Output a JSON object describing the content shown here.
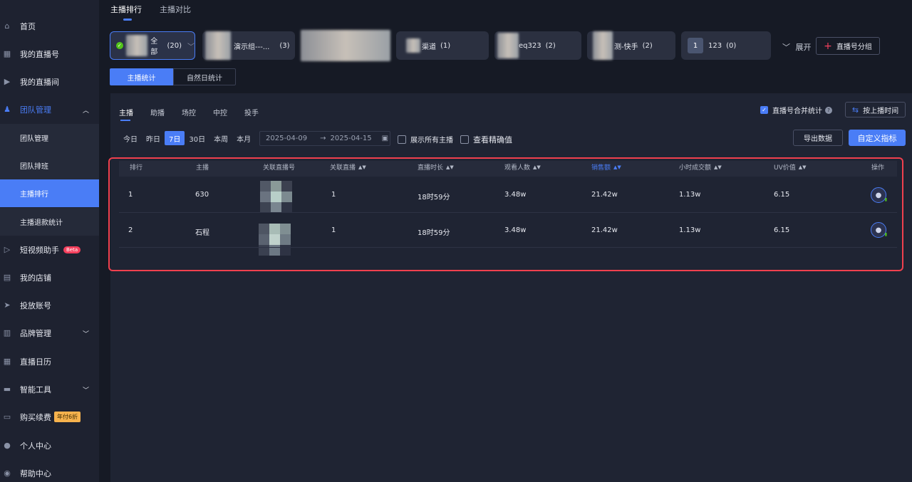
{
  "sidebar": {
    "items": [
      {
        "label": "首页",
        "icon": "home-icon",
        "glyph": "⌂"
      },
      {
        "label": "我的直播号",
        "icon": "grid-icon",
        "glyph": "▦"
      },
      {
        "label": "我的直播间",
        "icon": "play-icon",
        "glyph": "▶"
      },
      {
        "label": "团队管理",
        "icon": "team-icon",
        "glyph": "♟",
        "chevron": "︿"
      },
      {
        "label": "团队管理"
      },
      {
        "label": "团队排班"
      },
      {
        "label": "主播排行"
      },
      {
        "label": "主播退款统计"
      },
      {
        "label": "短视频助手",
        "icon": "video-icon",
        "glyph": "▷",
        "badge": "Beta"
      },
      {
        "label": "我的店铺",
        "icon": "store-icon",
        "glyph": "▤"
      },
      {
        "label": "投放账号",
        "icon": "send-icon",
        "glyph": "➤"
      },
      {
        "label": "品牌管理",
        "icon": "chart-icon",
        "glyph": "▥",
        "chevron": "﹀"
      },
      {
        "label": "直播日历",
        "icon": "calendar-icon",
        "glyph": "▦"
      },
      {
        "label": "智能工具",
        "icon": "tool-icon",
        "glyph": "▬",
        "chevron": "﹀"
      },
      {
        "label": "购买续费",
        "icon": "card-icon",
        "glyph": "▭",
        "badge": "年付6折"
      },
      {
        "label": "个人中心",
        "icon": "user-icon",
        "glyph": "●"
      },
      {
        "label": "帮助中心",
        "icon": "help-icon",
        "glyph": "◉"
      }
    ]
  },
  "top_tabs": [
    "主播排行",
    "主播对比"
  ],
  "groups": [
    {
      "label": "全部",
      "count": "(20)",
      "chevron": "﹀"
    },
    {
      "label": "演示组---...",
      "count": "(3)"
    },
    {
      "label": "渠道",
      "count": "(1)"
    },
    {
      "label": "eq323",
      "count": "(2)"
    },
    {
      "label": "测-快手",
      "count": "(2)"
    },
    {
      "number": "1",
      "label": "123",
      "count": "(0)"
    }
  ],
  "expand": {
    "chevron": "﹀",
    "label": "展开"
  },
  "add_group": {
    "plus": "+",
    "label": "直播号分组"
  },
  "stat_toggle": [
    "主播统计",
    "自然日统计"
  ],
  "sub_tabs": [
    "主播",
    "助播",
    "场控",
    "中控",
    "投手"
  ],
  "merge": {
    "check": "✓",
    "label": "直播号合并统计",
    "help": "?"
  },
  "sort_time": {
    "icon": "⇆",
    "label": "按上播时间"
  },
  "quick_range": [
    "今日",
    "昨日",
    "7日",
    "30日",
    "本周",
    "本月"
  ],
  "date": {
    "start": "2025-04-09",
    "arrow": "→",
    "end": "2025-04-15",
    "cal": "▣"
  },
  "options": {
    "show_all": "展示所有主播",
    "precise": "查看精确值"
  },
  "buttons": {
    "export": "导出数据",
    "custom": "自定义指标"
  },
  "table": {
    "sort_glyph": "▲▼",
    "headers": [
      "排行",
      "主播",
      "关联直播号",
      "关联直播",
      "直播时长",
      "观看人数",
      "销售额",
      "小时成交额",
      "UV价值",
      "操作"
    ],
    "rows": [
      [
        "1",
        "630",
        "",
        "1",
        "18时59分",
        "3.48w",
        "21.42w",
        "1.13w",
        "6.15"
      ],
      [
        "2",
        "石程",
        "",
        "1",
        "18时59分",
        "3.48w",
        "21.42w",
        "1.13w",
        "6.15"
      ]
    ],
    "op_icon": "●",
    "op_bars": "▮"
  },
  "colors": {
    "accent": "#4a7df6",
    "outline": "#f0404e",
    "beta": "#f5405d",
    "discount": "#f6b24d"
  }
}
